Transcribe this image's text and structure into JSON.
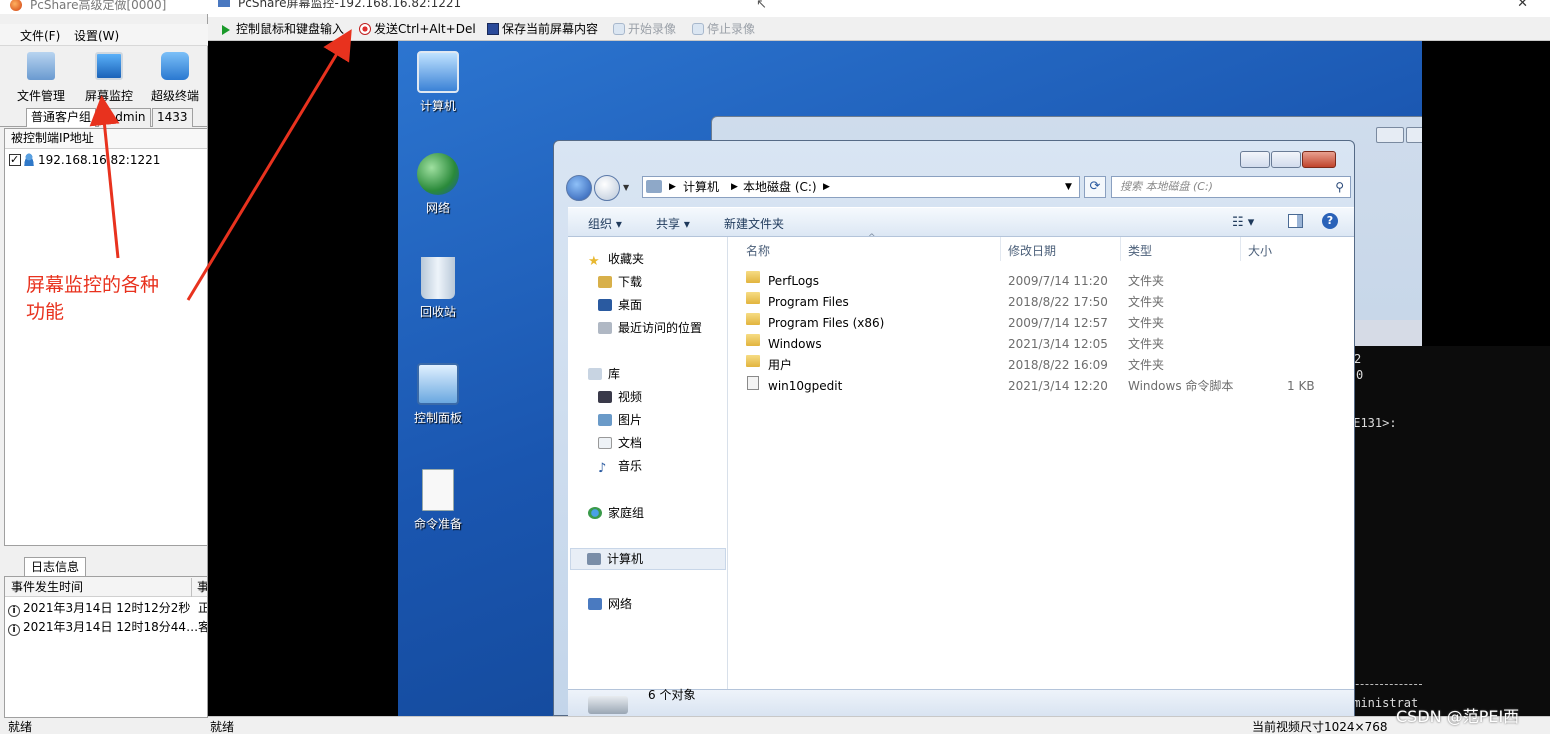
{
  "left_app": {
    "title": "PcShare高级定做[0000]",
    "menu": [
      "文件(F)",
      "设置(W)"
    ],
    "tools": [
      {
        "label": "文件管理",
        "icon": "file-manager-icon",
        "color": "#7aa8d8"
      },
      {
        "label": "屏幕监控",
        "icon": "screen-monitor-icon",
        "color": "#2a7fd0"
      },
      {
        "label": "超级终端",
        "icon": "terminal-phone-icon",
        "color": "#3a90e0"
      }
    ],
    "tabs": [
      "普通客户组",
      "radmin",
      "1433"
    ],
    "list_header": "被控制端IP地址",
    "client": "192.168.16.82:1221",
    "log_tab": "日志信息",
    "log_headers": [
      "事件发生时间",
      "事"
    ],
    "log_rows": [
      {
        "time": "2021年3月14日 12时12分2秒",
        "tail": "正"
      },
      {
        "time": "2021年3月14日 12时18分44…",
        "tail": "客"
      }
    ],
    "status": "就绪"
  },
  "viewer": {
    "title": "PcShare屏幕监控-192.168.16.82:1221",
    "toolbar": [
      {
        "label": "控制鼠标和键盘输入",
        "icon": "play-icon",
        "enabled": true
      },
      {
        "label": "发送Ctrl+Alt+Del",
        "icon": "stop-icon",
        "enabled": true
      },
      {
        "label": "保存当前屏幕内容",
        "icon": "save-icon",
        "enabled": true
      },
      {
        "label": "开始录像",
        "icon": "record-start-icon",
        "enabled": false
      },
      {
        "label": "停止录像",
        "icon": "record-stop-icon",
        "enabled": false
      }
    ],
    "status_left": "就绪",
    "status_right": "当前视频尺寸1024×768"
  },
  "desktop": {
    "icons": [
      {
        "label": "计算机",
        "icon": "computer-icon"
      },
      {
        "label": "网络",
        "icon": "network-globe-icon"
      },
      {
        "label": "回收站",
        "icon": "recycle-bin-icon"
      },
      {
        "label": "控制面板",
        "icon": "control-panel-icon"
      },
      {
        "label": "命令准备",
        "icon": "document-icon"
      }
    ]
  },
  "console_lines": [
    "2",
    "0",
    "RE131>:",
    "dministrat"
  ],
  "explorer": {
    "breadcrumb": [
      "计算机",
      "本地磁盘 (C:)"
    ],
    "search_placeholder": "搜索 本地磁盘 (C:)",
    "commands": [
      "组织 ▾",
      "共享 ▾",
      "新建文件夹"
    ],
    "nav": {
      "favorites": "收藏夹",
      "favorite_items": [
        "下载",
        "桌面",
        "最近访问的位置"
      ],
      "libraries": "库",
      "library_items": [
        "视频",
        "图片",
        "文档",
        "音乐"
      ],
      "homegroup": "家庭组",
      "computer": "计算机",
      "network": "网络"
    },
    "columns": [
      "名称",
      "修改日期",
      "类型",
      "大小"
    ],
    "files": [
      {
        "name": "PerfLogs",
        "date": "2009/7/14 11:20",
        "type": "文件夹",
        "size": "",
        "kind": "folder"
      },
      {
        "name": "Program Files",
        "date": "2018/8/22 17:50",
        "type": "文件夹",
        "size": "",
        "kind": "folder"
      },
      {
        "name": "Program Files (x86)",
        "date": "2009/7/14 12:57",
        "type": "文件夹",
        "size": "",
        "kind": "folder"
      },
      {
        "name": "Windows",
        "date": "2021/3/14 12:05",
        "type": "文件夹",
        "size": "",
        "kind": "folder"
      },
      {
        "name": "用户",
        "date": "2018/8/22 16:09",
        "type": "文件夹",
        "size": "",
        "kind": "folder"
      },
      {
        "name": "win10gpedit",
        "date": "2021/3/14 12:20",
        "type": "Windows 命令脚本",
        "size": "1 KB",
        "kind": "script"
      }
    ],
    "item_count": "6 个对象"
  },
  "annotation": {
    "text_line1": "屏幕监控的各种",
    "text_line2": "功能",
    "color": "#e8321e"
  },
  "watermark": "CSDN @范PEI西"
}
